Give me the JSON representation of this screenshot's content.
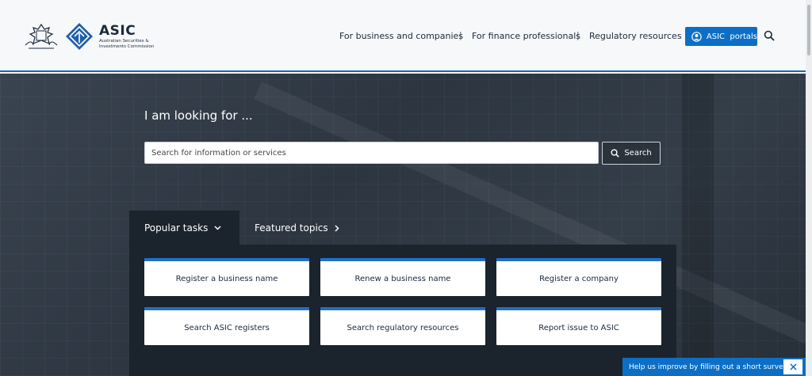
{
  "header": {
    "brand_name": "ASIC",
    "brand_sub": "Australian Securities & Investments Commission",
    "nav": [
      "For business and companies",
      "For finance professionals",
      "Regulatory resources"
    ],
    "separator": "|",
    "portals_label": "ASIC  portals"
  },
  "hero": {
    "title": "I am looking for ...",
    "search_placeholder": "Search for information or services",
    "search_value": "",
    "search_button": "Search"
  },
  "tabs": {
    "popular": "Popular tasks",
    "featured": "Featured topics"
  },
  "tasks": [
    "Register a business name",
    "Renew a business name",
    "Register a company",
    "Search ASIC registers",
    "Search regulatory resources",
    "Report issue to ASIC"
  ],
  "survey": {
    "label": "Help us improve by filling out a short survey"
  },
  "colors": {
    "accent": "#0b6fc7",
    "card_top": "#1f6fc9",
    "panel": "#1b232c"
  }
}
